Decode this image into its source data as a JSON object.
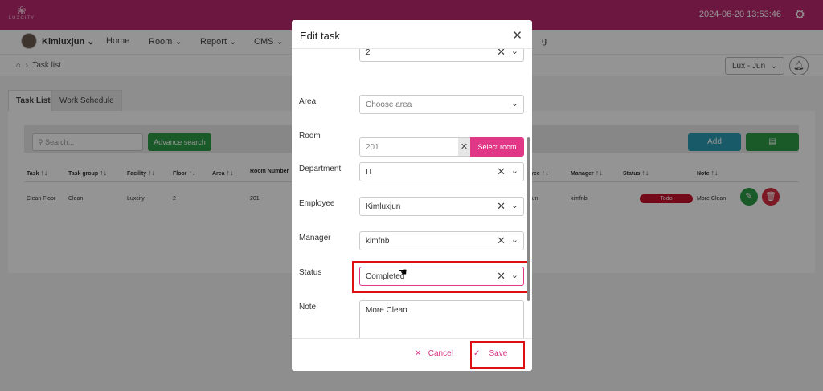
{
  "app": {
    "brand": "LUXCITY",
    "datetime": "2024-06-20 13:53:46"
  },
  "nav": {
    "user": "Kimluxjun",
    "items": [
      "Home",
      "Room",
      "Report",
      "CMS",
      "g"
    ]
  },
  "breadcrumb": {
    "current": "Task list"
  },
  "property_select": "Lux - Jun",
  "tabs": [
    "Task List",
    "Work Schedule"
  ],
  "filters": {
    "search_placeholder": "Search...",
    "advanced_search": "Advance search",
    "add": "Add"
  },
  "table": {
    "headers": [
      "Task",
      "Task group",
      "Facility",
      "Floor",
      "Area",
      "Room Number",
      "yee",
      "Manager",
      "Status",
      "Note"
    ],
    "row": {
      "task": "Clean Floor",
      "task_group": "Clean",
      "facility": "Luxcity",
      "floor": "2",
      "area": "",
      "room": "201",
      "employee": "jun",
      "manager": "kimfnb",
      "status": "Todo",
      "note": "More Clean"
    }
  },
  "modal": {
    "title": "Edit task",
    "fields": {
      "floor_value": "2",
      "area_label": "Area",
      "area_placeholder": "Choose area",
      "room_label": "Room",
      "room_value": "201",
      "select_room": "Select room",
      "department_label": "Department",
      "department_value": "IT",
      "employee_label": "Employee",
      "employee_value": "Kimluxjun",
      "manager_label": "Manager",
      "manager_value": "kimfnb",
      "status_label": "Status",
      "status_value": "Completed",
      "note_label": "Note",
      "note_value": "More Clean"
    },
    "cancel": "Cancel",
    "save": "Save"
  },
  "colors": {
    "brand": "#b8286f",
    "accent": "#e03787",
    "highlight": "#dd1111"
  }
}
